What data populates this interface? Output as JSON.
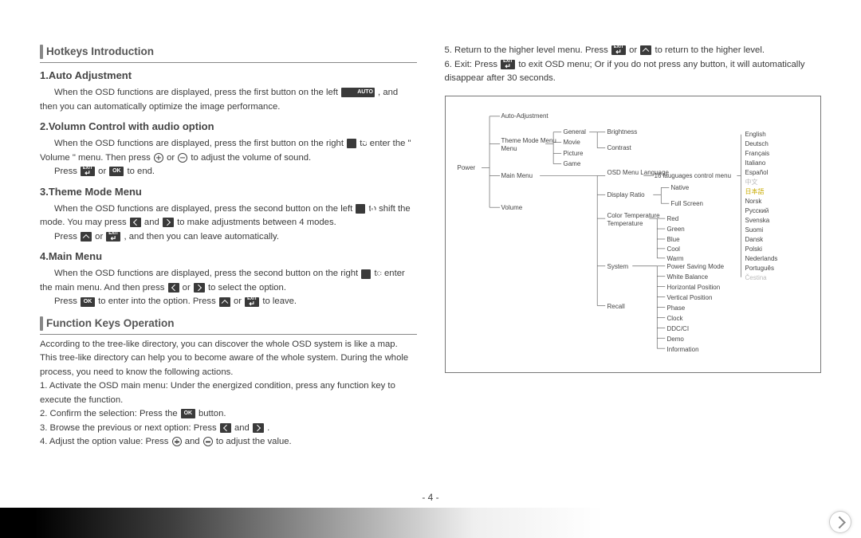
{
  "page_number_display": "- 4 -",
  "left": {
    "hotkeys_title": "Hotkeys Introduction",
    "s1_title": "1.Auto Adjustment",
    "s1_p_a": "When the OSD functions are displayed, press the first button on the left ",
    "s1_p_b": " , and then you can automatically optimize the image performance.",
    "s2_title": "2.Volumn Control with audio option",
    "s2_p1_a": "When the OSD functions are displayed, press the first button on the right ",
    "s2_p1_b": " to enter the \" Volume \" menu. Then press ",
    "s2_p1_c": " or ",
    "s2_p1_d": " to adjust the volume of sound.",
    "s2_p2_a": "Press ",
    "s2_p2_b": " or ",
    "s2_p2_c": " to end.",
    "s3_title": "3.Theme Mode Menu",
    "s3_p1_a": "When the OSD functions are displayed, press the second button on the left ",
    "s3_p1_b": " to shift the mode. You may press ",
    "s3_p1_c": " and ",
    "s3_p1_d": " to make adjustments between 4 modes.",
    "s3_p2_a": "Press ",
    "s3_p2_b": " or ",
    "s3_p2_c": " , and then you can leave automatically.",
    "s4_title": "4.Main Menu",
    "s4_p1_a": "When the OSD functions are displayed, press the second button on the right ",
    "s4_p1_b": " to enter the main menu. And then press ",
    "s4_p1_c": " or ",
    "s4_p1_d": " to select the option.",
    "s4_p2_a": "Press ",
    "s4_p2_b": " to enter into the option. Press ",
    "s4_p2_c": " or ",
    "s4_p2_d": " to leave.",
    "fk_title": "Function Keys Operation",
    "fk_intro": "According to the tree-like directory, you can discover the whole OSD system is like a map. This tree-like directory can help you to become aware of the whole system. During the whole process, you need to know the following actions.",
    "fk_1": "1. Activate the OSD main menu: Under the energized condition, press any function key to execute the function.",
    "fk_2a": "2. Confirm the selection: Press the ",
    "fk_2b": " button.",
    "fk_3a": "3. Browse the previous or next option: Press ",
    "fk_3b": " and ",
    "fk_3c": " .",
    "fk_4a": "4. Adjust the option value: Press ",
    "fk_4b": " and ",
    "fk_4c": " to adjust the value."
  },
  "right": {
    "p5a": "5. Return to the higher level menu. Press ",
    "p5b": " or ",
    "p5c": " to return to the higher level.",
    "p6a": "6. Exit: Press ",
    "p6b": " to exit OSD menu; Or if you do not press any button, it will automatically disappear after 30 seconds."
  },
  "tree": {
    "root": "Power",
    "lvl1": [
      "Auto-Adjustment",
      "Theme Mode Menu",
      "Main Menu",
      "Volume"
    ],
    "theme_modes": [
      "General",
      "Movie",
      "Picture",
      "Game"
    ],
    "main_menu": [
      "Brightness",
      "Contrast",
      "OSD Menu Language",
      "Display Ratio",
      "Color Temperature",
      "System",
      "Recall"
    ],
    "ratio": [
      "Native",
      "Full Screen"
    ],
    "colors": [
      "Red",
      "Green",
      "Blue",
      "Cool",
      "Warm"
    ],
    "system": [
      "Power Saving Mode",
      "White Balance",
      "Horizontal Position",
      "Vertical Position",
      "Phase",
      "Clock",
      "DDC/CI",
      "Demo",
      "Information"
    ],
    "lang_note": "16 lauguages control menu",
    "languages": [
      "English",
      "Deutsch",
      "Français",
      "Italiano",
      "Español",
      "中文",
      "日本語",
      "Norsk",
      "Русский",
      "Svenska",
      "Suomi",
      "Dansk",
      "Polski",
      "Nederlands",
      "Português",
      "Čestina"
    ]
  },
  "icon_labels": {
    "auto": "AUTO",
    "ok": "OK",
    "exit": "EXIT"
  }
}
